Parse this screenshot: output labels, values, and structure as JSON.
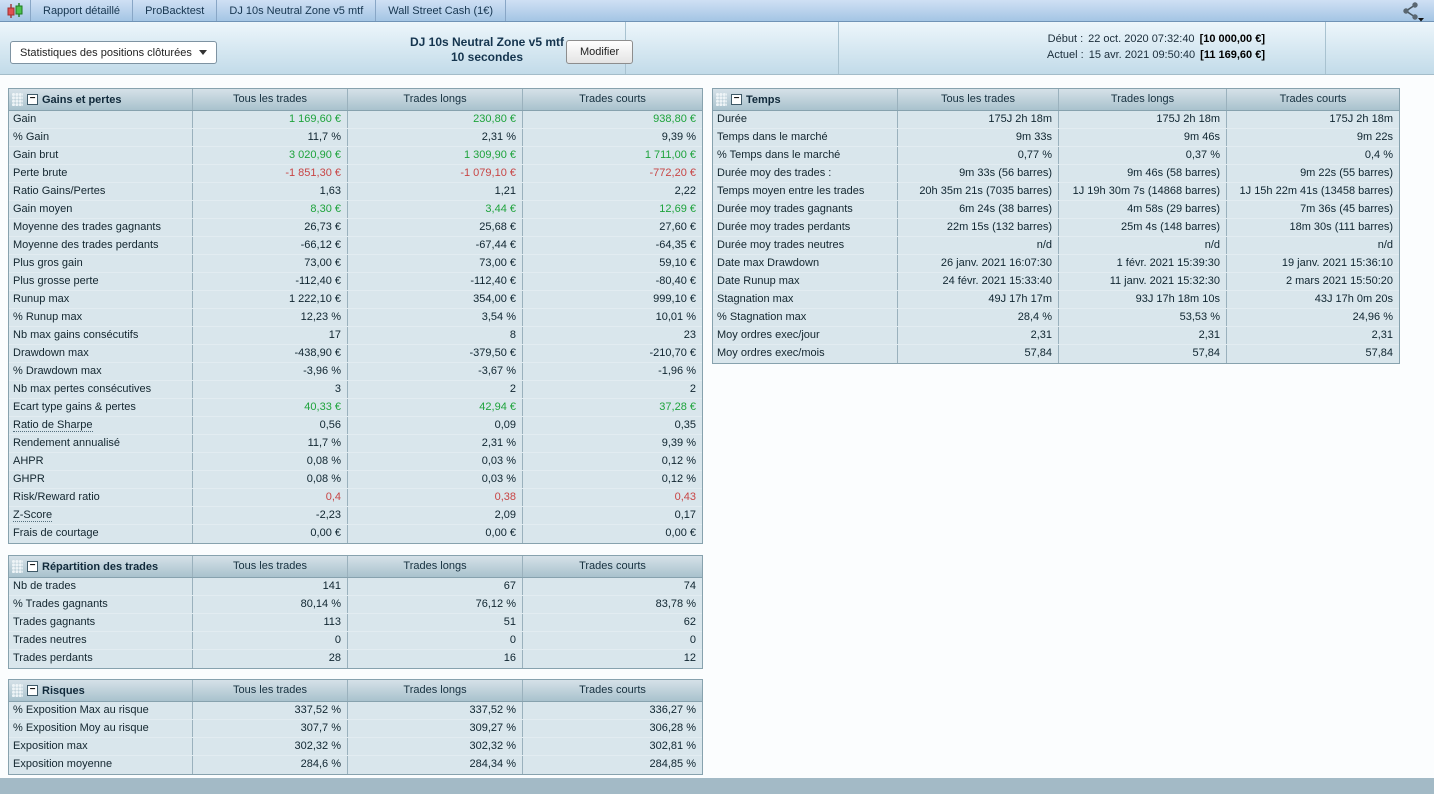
{
  "tabbar": {
    "tabs": [
      {
        "label": "Rapport détaillé"
      },
      {
        "label": "ProBacktest"
      },
      {
        "label": "DJ 10s Neutral Zone v5 mtf"
      },
      {
        "label": "Wall Street Cash (1€)"
      }
    ]
  },
  "header": {
    "filter_label": "Statistiques des positions clôturées",
    "title_line1": "DJ 10s Neutral Zone v5 mtf",
    "title_line2": "10 secondes",
    "modify_label": "Modifier",
    "start_label": "Début :",
    "start_datetime": "22 oct. 2020 07:32:40",
    "start_amount": "[10 000,00 €]",
    "current_label": "Actuel :",
    "current_datetime": "15 avr. 2021 09:50:40",
    "current_amount": "[11 169,60 €]"
  },
  "columns": {
    "all": "Tous les trades",
    "long": "Trades longs",
    "short": "Trades courts"
  },
  "colors": {
    "positive": "#1ea33c",
    "negative": "#c84545"
  },
  "tables": {
    "gains": {
      "title": "Gains et pertes",
      "rows": [
        {
          "label": "Gain",
          "values": [
            "1 169,60 €",
            "230,80 €",
            "938,80 €"
          ],
          "cls": "pos"
        },
        {
          "label": "% Gain",
          "values": [
            "11,7 %",
            "2,31 %",
            "9,39 %"
          ]
        },
        {
          "label": "Gain brut",
          "values": [
            "3 020,90 €",
            "1 309,90 €",
            "1 711,00 €"
          ],
          "cls": "pos"
        },
        {
          "label": "Perte brute",
          "values": [
            "-1 851,30 €",
            "-1 079,10 €",
            "-772,20 €"
          ],
          "cls": "neg"
        },
        {
          "label": "Ratio Gains/Pertes",
          "values": [
            "1,63",
            "1,21",
            "2,22"
          ]
        },
        {
          "label": "Gain moyen",
          "values": [
            "8,30 €",
            "3,44 €",
            "12,69 €"
          ],
          "cls": "pos"
        },
        {
          "label": "Moyenne des trades gagnants",
          "values": [
            "26,73 €",
            "25,68 €",
            "27,60 €"
          ]
        },
        {
          "label": "Moyenne des trades perdants",
          "values": [
            "-66,12 €",
            "-67,44 €",
            "-64,35 €"
          ]
        },
        {
          "label": "Plus gros gain",
          "values": [
            "73,00 €",
            "73,00 €",
            "59,10 €"
          ]
        },
        {
          "label": "Plus grosse perte",
          "values": [
            "-112,40 €",
            "-112,40 €",
            "-80,40 €"
          ]
        },
        {
          "label": "Runup max",
          "values": [
            "1 222,10 €",
            "354,00 €",
            "999,10 €"
          ]
        },
        {
          "label": "% Runup max",
          "values": [
            "12,23 %",
            "3,54 %",
            "10,01 %"
          ]
        },
        {
          "label": "Nb max gains consécutifs",
          "values": [
            "17",
            "8",
            "23"
          ]
        },
        {
          "label": "Drawdown max",
          "values": [
            "-438,90 €",
            "-379,50 €",
            "-210,70 €"
          ]
        },
        {
          "label": "% Drawdown max",
          "values": [
            "-3,96 %",
            "-3,67 %",
            "-1,96 %"
          ]
        },
        {
          "label": "Nb max pertes consécutives",
          "values": [
            "3",
            "2",
            "2"
          ]
        },
        {
          "label": "Ecart type gains & pertes",
          "values": [
            "40,33 €",
            "42,94 €",
            "37,28 €"
          ],
          "cls": "pos"
        },
        {
          "label": "Ratio de Sharpe",
          "values": [
            "0,56",
            "0,09",
            "0,35"
          ],
          "u": true
        },
        {
          "label": "Rendement annualisé",
          "values": [
            "11,7 %",
            "2,31 %",
            "9,39 %"
          ]
        },
        {
          "label": "AHPR",
          "values": [
            "0,08 %",
            "0,03 %",
            "0,12 %"
          ]
        },
        {
          "label": "GHPR",
          "values": [
            "0,08 %",
            "0,03 %",
            "0,12 %"
          ]
        },
        {
          "label": "Risk/Reward ratio",
          "values": [
            "0,4",
            "0,38",
            "0,43"
          ],
          "cls": "neg"
        },
        {
          "label": "Z-Score",
          "values": [
            "-2,23",
            "2,09",
            "0,17"
          ],
          "u": true
        },
        {
          "label": "Frais de courtage",
          "values": [
            "0,00 €",
            "0,00 €",
            "0,00 €"
          ]
        }
      ]
    },
    "temps": {
      "title": "Temps",
      "rows": [
        {
          "label": "Durée",
          "values": [
            "175J 2h 18m",
            "175J 2h 18m",
            "175J 2h 18m"
          ]
        },
        {
          "label": "Temps dans le marché",
          "values": [
            "9m 33s",
            "9m 46s",
            "9m 22s"
          ]
        },
        {
          "label": "% Temps dans le marché",
          "values": [
            "0,77 %",
            "0,37 %",
            "0,4 %"
          ]
        },
        {
          "label": "Durée moy des trades :",
          "values": [
            "9m 33s (56 barres)",
            "9m 46s (58 barres)",
            "9m 22s (55 barres)"
          ]
        },
        {
          "label": "Temps moyen entre les trades",
          "values": [
            "20h 35m 21s (7035 barres)",
            "1J 19h 30m 7s (14868 barres)",
            "1J 15h 22m 41s (13458 barres)"
          ]
        },
        {
          "label": "Durée moy trades gagnants",
          "values": [
            "6m 24s (38 barres)",
            "4m 58s (29 barres)",
            "7m 36s (45 barres)"
          ]
        },
        {
          "label": "Durée moy trades perdants",
          "values": [
            "22m 15s (132 barres)",
            "25m 4s (148 barres)",
            "18m 30s (111 barres)"
          ]
        },
        {
          "label": "Durée moy trades neutres",
          "values": [
            "n/d",
            "n/d",
            "n/d"
          ]
        },
        {
          "label": "Date max Drawdown",
          "values": [
            "26 janv. 2021 16:07:30",
            "1 févr. 2021 15:39:30",
            "19 janv. 2021 15:36:10"
          ]
        },
        {
          "label": "Date Runup max",
          "values": [
            "24 févr. 2021 15:33:40",
            "11 janv. 2021 15:32:30",
            "2 mars 2021 15:50:20"
          ]
        },
        {
          "label": "Stagnation max",
          "values": [
            "49J 17h 17m",
            "93J 17h 18m 10s",
            "43J 17h 0m 20s"
          ]
        },
        {
          "label": "% Stagnation max",
          "values": [
            "28,4 %",
            "53,53 %",
            "24,96 %"
          ]
        },
        {
          "label": "Moy ordres exec/jour",
          "values": [
            "2,31",
            "2,31",
            "2,31"
          ]
        },
        {
          "label": "Moy ordres exec/mois",
          "values": [
            "57,84",
            "57,84",
            "57,84"
          ]
        }
      ]
    },
    "repartition": {
      "title": "Répartition des trades",
      "rows": [
        {
          "label": "Nb de trades",
          "values": [
            "141",
            "67",
            "74"
          ]
        },
        {
          "label": "% Trades gagnants",
          "values": [
            "80,14 %",
            "76,12 %",
            "83,78 %"
          ]
        },
        {
          "label": "Trades gagnants",
          "values": [
            "113",
            "51",
            "62"
          ]
        },
        {
          "label": "Trades neutres",
          "values": [
            "0",
            "0",
            "0"
          ]
        },
        {
          "label": "Trades perdants",
          "values": [
            "28",
            "16",
            "12"
          ]
        }
      ]
    },
    "risques": {
      "title": "Risques",
      "rows": [
        {
          "label": "% Exposition Max au risque",
          "values": [
            "337,52 %",
            "337,52 %",
            "336,27 %"
          ]
        },
        {
          "label": "% Exposition Moy au risque",
          "values": [
            "307,7 %",
            "309,27 %",
            "306,28 %"
          ]
        },
        {
          "label": "Exposition max",
          "values": [
            "302,32 %",
            "302,32 %",
            "302,81 %"
          ]
        },
        {
          "label": "Exposition moyenne",
          "values": [
            "284,6 %",
            "284,34 %",
            "284,85 %"
          ]
        }
      ]
    }
  }
}
